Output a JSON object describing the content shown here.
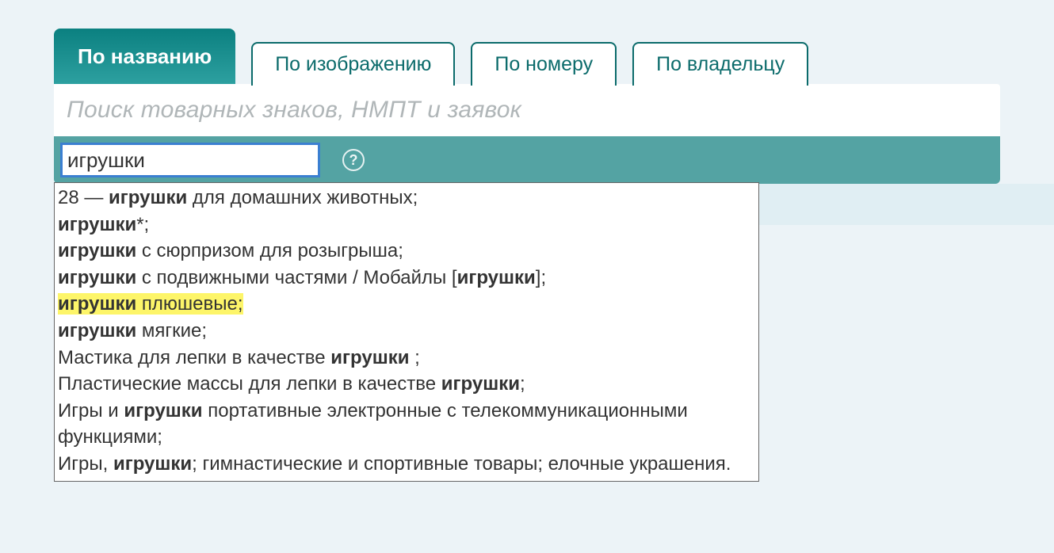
{
  "tabs": [
    {
      "label": "По названию",
      "active": true
    },
    {
      "label": "По изображению",
      "active": false
    },
    {
      "label": "По номеру",
      "active": false
    },
    {
      "label": "По владельцу",
      "active": false
    }
  ],
  "search": {
    "placeholder": "Поиск товарных знаков, НМПТ и заявок"
  },
  "filter": {
    "value": "игрушки"
  },
  "help": {
    "symbol": "?"
  },
  "dropdown": {
    "class_prefix": "28 — ",
    "items": [
      {
        "segments": [
          {
            "t": "28 — "
          },
          {
            "t": "игрушки",
            "b": true
          },
          {
            "t": " для домашних животных;"
          }
        ]
      },
      {
        "segments": [
          {
            "t": "игрушки",
            "b": true
          },
          {
            "t": "*;"
          }
        ]
      },
      {
        "segments": [
          {
            "t": "игрушки",
            "b": true
          },
          {
            "t": " с сюрпризом для розыгрыша;"
          }
        ]
      },
      {
        "segments": [
          {
            "t": "игрушки",
            "b": true
          },
          {
            "t": " с подвижными частями / Мобайлы ["
          },
          {
            "t": "игрушки",
            "b": true
          },
          {
            "t": "];"
          }
        ]
      },
      {
        "highlight": true,
        "segments": [
          {
            "t": "игрушки",
            "b": true
          },
          {
            "t": " плюшевые;"
          }
        ]
      },
      {
        "segments": [
          {
            "t": "игрушки",
            "b": true
          },
          {
            "t": " мягкие;"
          }
        ]
      },
      {
        "segments": [
          {
            "t": "Мастика для лепки в качестве "
          },
          {
            "t": "игрушки",
            "b": true
          },
          {
            "t": " ;"
          }
        ]
      },
      {
        "segments": [
          {
            "t": "Пластические массы для лепки в качестве "
          },
          {
            "t": "игрушки",
            "b": true
          },
          {
            "t": ";"
          }
        ]
      },
      {
        "segments": [
          {
            "t": "Игры и "
          },
          {
            "t": "игрушки",
            "b": true
          },
          {
            "t": " портативные электронные с телекоммуникационными функциями;"
          }
        ]
      },
      {
        "segments": [
          {
            "t": "Игры, "
          },
          {
            "t": "игрушки",
            "b": true
          },
          {
            "t": "; гимнастические и спортивные товары; елочные украшения."
          }
        ]
      }
    ]
  }
}
